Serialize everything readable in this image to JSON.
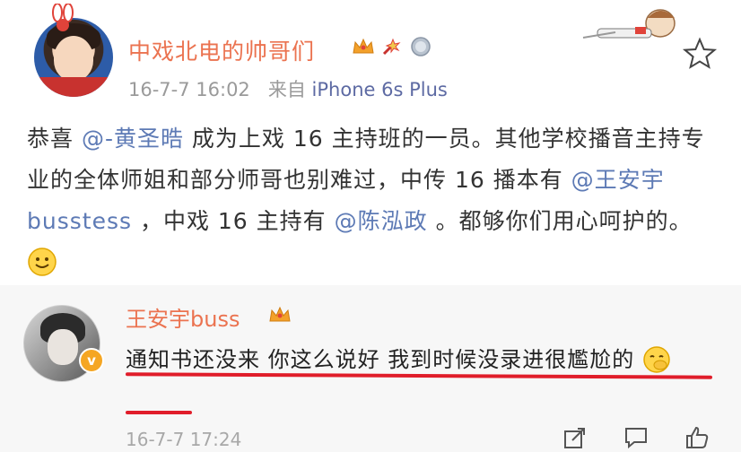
{
  "post": {
    "username": "中戏北电的帅哥们",
    "time": "16-7-7 16:02",
    "source_prefix": "来自",
    "source_device": "iPhone 6s Plus",
    "content": {
      "part1": "恭喜 ",
      "mention1": "@-黄圣晧",
      "part2": " 成为上戏 16 主持班的一员。其他学校播音主持专业的全体师姐和部分师哥也别难过，中传 16 播本有 ",
      "mention2": "@王安宇 busstess",
      "part3": " ，中戏 16 主持有 ",
      "mention3": "@陈泓政",
      "part4": " 。都够你们用心呵护的。",
      "emoji": "🙂"
    }
  },
  "comment": {
    "username": "王安宇buss",
    "text": "通知书还没来 你这么说好 我到时候没录进很尷尬的",
    "emoji": "🤭",
    "time": "16-7-7 17:24",
    "verified_mark": "v"
  },
  "colors": {
    "username": "#eb7350",
    "mention": "#5d7ab5",
    "underline": "#e01d2a",
    "verified": "#f5a623"
  }
}
